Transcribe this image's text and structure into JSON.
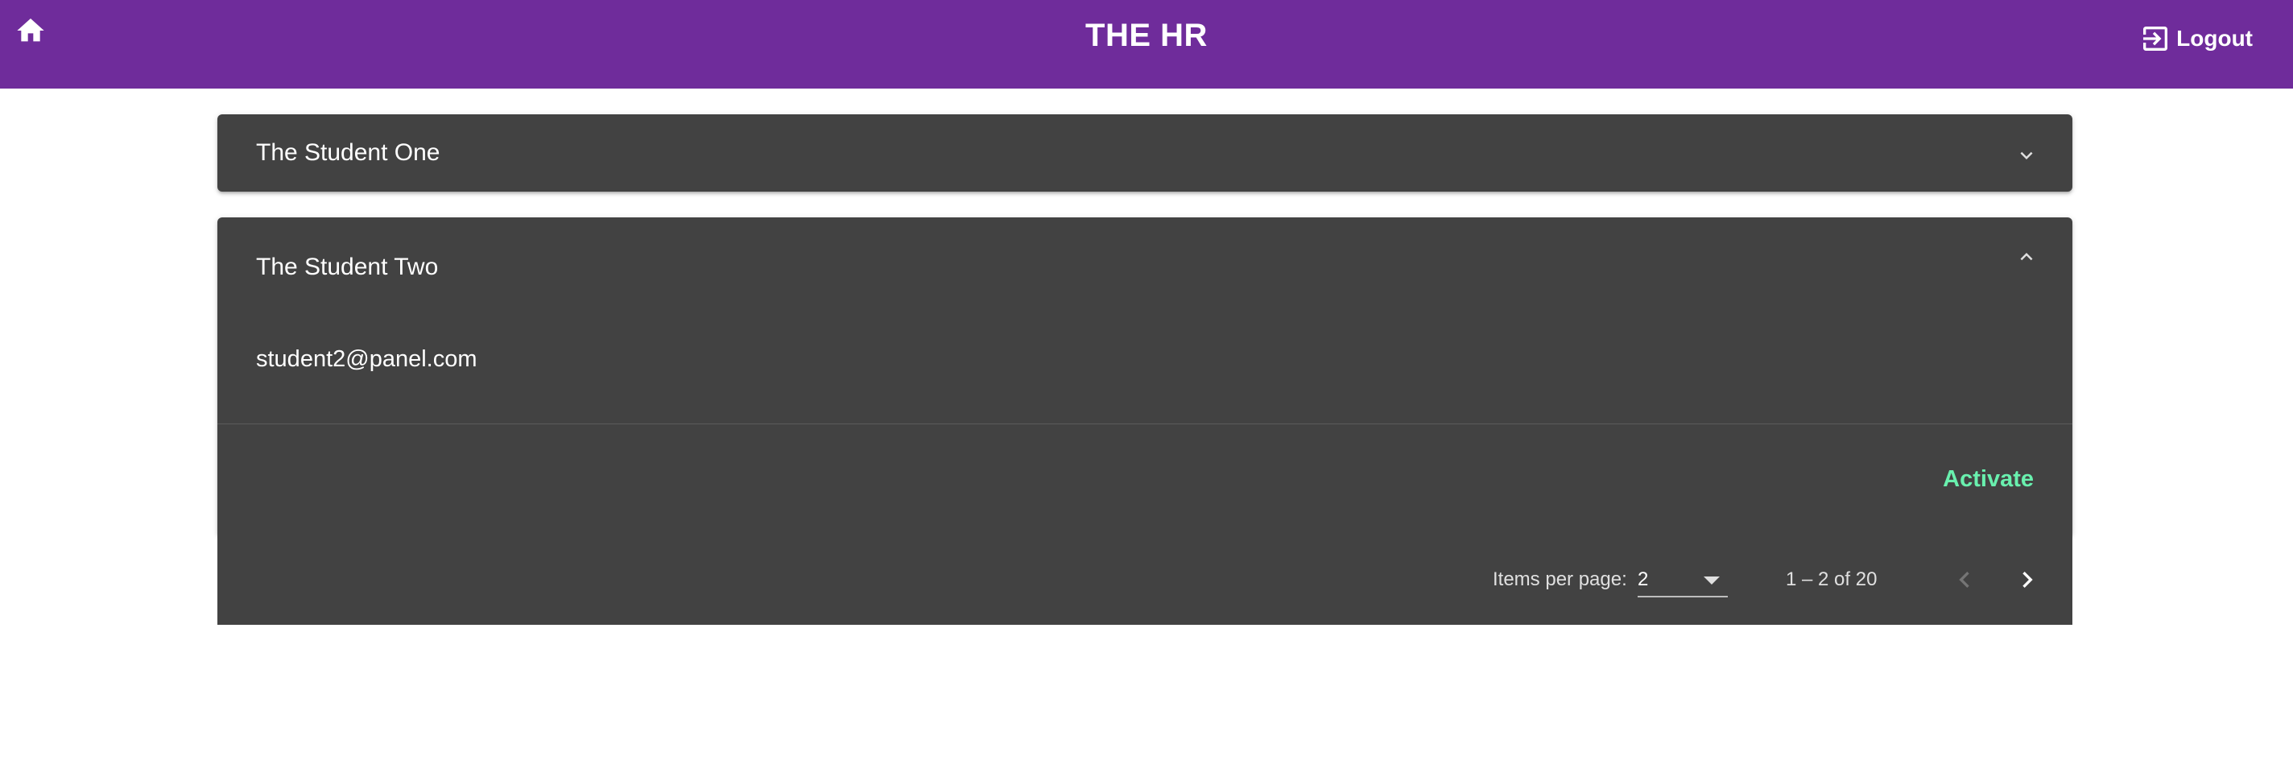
{
  "header": {
    "title": "THE HR",
    "home_icon": "home-icon",
    "logout_label": "Logout",
    "logout_icon": "logout-icon",
    "background_color": "#6f2c9b"
  },
  "students": [
    {
      "name": "The Student One",
      "expanded": false
    },
    {
      "name": "The Student Two",
      "expanded": true,
      "email": "student2@panel.com",
      "action_label": "Activate",
      "action_color": "#69f0ae"
    }
  ],
  "paginator": {
    "items_per_page_label": "Items per page:",
    "items_per_page_value": "2",
    "range_label": "1 – 2 of 20",
    "prev_disabled": true,
    "next_disabled": false
  },
  "colors": {
    "panel_background": "#424242",
    "page_background": "#ffffff"
  }
}
